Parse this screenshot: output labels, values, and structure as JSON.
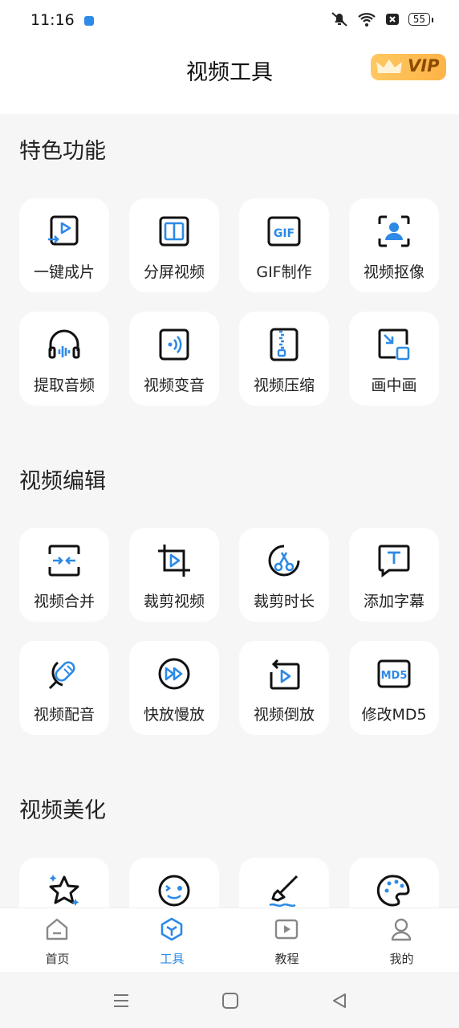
{
  "status_bar": {
    "time": "11:16",
    "battery": "55"
  },
  "header": {
    "title": "视频工具",
    "vip_label": "VIP"
  },
  "sections": [
    {
      "title": "特色功能",
      "items": [
        {
          "label": "一键成片",
          "icon": "play-export-icon"
        },
        {
          "label": "分屏视频",
          "icon": "split-screen-icon"
        },
        {
          "label": "GIF制作",
          "icon": "gif-icon"
        },
        {
          "label": "视频抠像",
          "icon": "portrait-cutout-icon"
        },
        {
          "label": "提取音频",
          "icon": "headphones-icon"
        },
        {
          "label": "视频变音",
          "icon": "sound-wave-icon"
        },
        {
          "label": "视频压缩",
          "icon": "zip-file-icon"
        },
        {
          "label": "画中画",
          "icon": "picture-in-picture-icon"
        }
      ]
    },
    {
      "title": "视频编辑",
      "items": [
        {
          "label": "视频合并",
          "icon": "merge-icon"
        },
        {
          "label": "裁剪视频",
          "icon": "crop-icon"
        },
        {
          "label": "裁剪时长",
          "icon": "trim-duration-icon"
        },
        {
          "label": "添加字幕",
          "icon": "subtitle-icon"
        },
        {
          "label": "视频配音",
          "icon": "microphone-icon"
        },
        {
          "label": "快放慢放",
          "icon": "fast-forward-icon"
        },
        {
          "label": "视频倒放",
          "icon": "reverse-play-icon"
        },
        {
          "label": "修改MD5",
          "icon": "md5-icon"
        }
      ]
    },
    {
      "title": "视频美化",
      "items": [
        {
          "label": "",
          "icon": "sparkle-star-icon"
        },
        {
          "label": "",
          "icon": "sticker-face-icon"
        },
        {
          "label": "",
          "icon": "brush-icon"
        },
        {
          "label": "",
          "icon": "palette-icon"
        }
      ]
    }
  ],
  "tabbar": {
    "items": [
      {
        "label": "首页",
        "icon": "home-icon"
      },
      {
        "label": "工具",
        "icon": "tools-cube-icon",
        "active": true
      },
      {
        "label": "教程",
        "icon": "tutorial-play-icon"
      },
      {
        "label": "我的",
        "icon": "profile-icon"
      }
    ]
  },
  "colors": {
    "accent": "#2d8ae6",
    "vip_gradient_start": "#ffc861",
    "vip_gradient_end": "#fdb347",
    "icon_dark": "#111111"
  }
}
